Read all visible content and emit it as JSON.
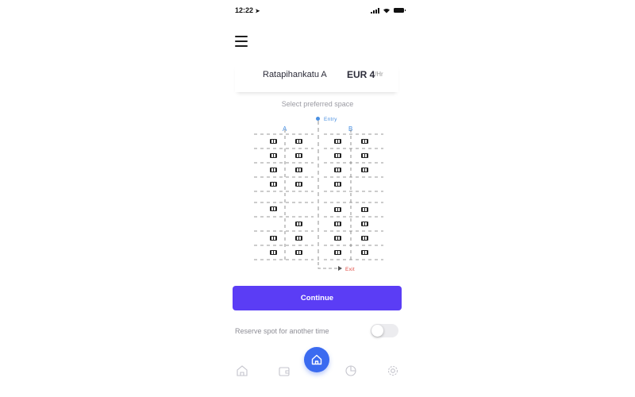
{
  "status_bar": {
    "time": "12:22",
    "icons": [
      "location-arrow-icon",
      "signal-icon",
      "wifi-icon",
      "battery-icon"
    ]
  },
  "header": {
    "menu_icon": "hamburger-menu-icon"
  },
  "location": {
    "name": "Ratapihankatu A",
    "price": "EUR 4",
    "unit": "/Hr"
  },
  "parking_map": {
    "prompt": "Select preferred space",
    "entry_label": "Entry",
    "exit_label": "Exit",
    "column_labels": [
      "A",
      "B"
    ],
    "colors": {
      "entry": "#4a90e2",
      "exit": "#e0463e",
      "lines": "#777777",
      "car": "#222222"
    }
  },
  "continue_button": {
    "label": "Continue",
    "color": "#5b3df5"
  },
  "reserve": {
    "label": "Reserve spot for another time",
    "toggle_on": false
  },
  "bottom_nav": {
    "items": [
      "home-outline-icon",
      "wallet-icon",
      "home-icon",
      "pie-chart-icon",
      "settings-icon"
    ],
    "active": "home-icon",
    "active_color": "#3b6bf0"
  }
}
